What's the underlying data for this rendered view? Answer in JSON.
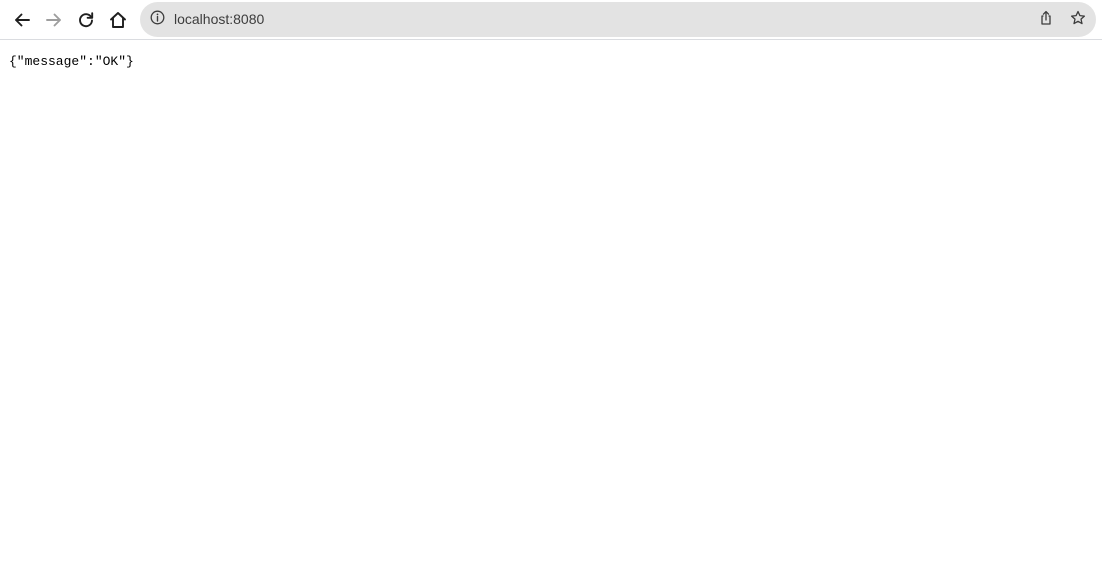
{
  "browser": {
    "address_bar": {
      "url": "localhost:8080"
    },
    "icons": {
      "back": "arrow-left-icon",
      "forward": "arrow-right-icon",
      "reload": "reload-icon",
      "home": "home-icon",
      "site_info": "info-icon",
      "share": "share-icon",
      "bookmark": "star-icon"
    },
    "colors": {
      "toolbar_bg": "#ffffff",
      "omnibox_bg": "#e3e3e3",
      "icon_active": "#1f1f1f",
      "icon_disabled": "#9e9e9e"
    }
  },
  "page": {
    "body_text": "{\"message\":\"OK\"}"
  }
}
